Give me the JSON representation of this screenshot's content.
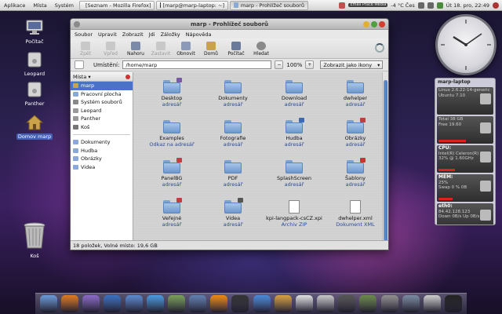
{
  "top_panel": {
    "menus": [
      "Aplikace",
      "Místa",
      "Systém"
    ],
    "tasks": [
      {
        "label": "[Seznam - Mozilla Firefox]",
        "active": false
      },
      {
        "label": "[marp@marp-laptop: ~]",
        "active": false
      },
      {
        "label": "marp - Prohlížeč souborů",
        "active": true
      }
    ],
    "email_badge": "Email Práce Média",
    "weather": "-4 °C Čes",
    "datetime": "Út 18. pro, 22:49"
  },
  "desktop": {
    "icons": [
      {
        "label": "Počítač",
        "selected": false
      },
      {
        "label": "Leopard",
        "selected": false
      },
      {
        "label": "Panther",
        "selected": false
      },
      {
        "label": "Domov marp",
        "selected": true
      },
      {
        "label": "Koš",
        "selected": false
      }
    ]
  },
  "window": {
    "title": "marp - Prohlížeč souborů",
    "menubar": [
      "Soubor",
      "Upravit",
      "Zobrazit",
      "Jdi",
      "Záložky",
      "Nápověda"
    ],
    "toolbar": [
      {
        "label": "Zpět",
        "icon": "back-arrow-icon",
        "enabled": false
      },
      {
        "label": "Vpřed",
        "icon": "forward-arrow-icon",
        "enabled": false
      },
      {
        "label": "Nahoru",
        "icon": "up-arrow-icon",
        "enabled": true
      },
      {
        "label": "Zastavit",
        "icon": "stop-icon",
        "enabled": false
      },
      {
        "label": "Obnovit",
        "icon": "refresh-icon",
        "enabled": true
      },
      {
        "label": "Domů",
        "icon": "home-icon",
        "enabled": true
      },
      {
        "label": "Počítač",
        "icon": "computer-icon",
        "enabled": true
      },
      {
        "label": "Hledat",
        "icon": "search-icon",
        "enabled": true
      }
    ],
    "location_label": "Umístění:",
    "location_value": "/home/marp",
    "zoom": "100%",
    "view_mode": "Zobrazit jako ikony",
    "sidebar": {
      "title": "Místa",
      "items": [
        {
          "label": "marp",
          "selected": true,
          "color": "#c9a24a"
        },
        {
          "label": "Pracovní plocha",
          "selected": false,
          "color": "#8aa8d8"
        },
        {
          "label": "Systém souborů",
          "selected": false,
          "color": "#888888"
        },
        {
          "label": "Leopard",
          "selected": false,
          "color": "#999999"
        },
        {
          "label": "Panther",
          "selected": false,
          "color": "#999999"
        },
        {
          "label": "Koš",
          "selected": false,
          "color": "#777777"
        }
      ],
      "bookmarks": [
        {
          "label": "Dokumenty",
          "color": "#8aa8d8"
        },
        {
          "label": "Hudba",
          "color": "#8aa8d8"
        },
        {
          "label": "Obrázky",
          "color": "#8aa8d8"
        },
        {
          "label": "Videa",
          "color": "#8aa8d8"
        }
      ]
    },
    "files": [
      {
        "name": "Desktop",
        "sub": "adresář",
        "type": "folder",
        "emblem": "#7a5aa8"
      },
      {
        "name": "Dokumenty",
        "sub": "adresář",
        "type": "folder",
        "emblem": ""
      },
      {
        "name": "Download",
        "sub": "adresář",
        "type": "folder",
        "emblem": ""
      },
      {
        "name": "dwhelper",
        "sub": "adresář",
        "type": "folder",
        "emblem": ""
      },
      {
        "name": "Examples",
        "sub": "Odkaz na adresář",
        "type": "folder",
        "emblem": ""
      },
      {
        "name": "Fotografie",
        "sub": "adresář",
        "type": "folder",
        "emblem": ""
      },
      {
        "name": "Hudba",
        "sub": "adresář",
        "type": "folder",
        "emblem": "#3a6ab8"
      },
      {
        "name": "Obrázky",
        "sub": "adresář",
        "type": "folder",
        "emblem": "#c04040"
      },
      {
        "name": "PanelBG",
        "sub": "adresář",
        "type": "folder",
        "emblem": "#c04040"
      },
      {
        "name": "PDF",
        "sub": "adresář",
        "type": "folder",
        "emblem": ""
      },
      {
        "name": "SplashScreen",
        "sub": "adresář",
        "type": "folder",
        "emblem": ""
      },
      {
        "name": "Šablony",
        "sub": "adresář",
        "type": "folder",
        "emblem": "#cc3333"
      },
      {
        "name": "Veřejné",
        "sub": "adresář",
        "type": "folder",
        "emblem": "#c04040"
      },
      {
        "name": "Videa",
        "sub": "adresář",
        "type": "folder",
        "emblem": "#555555"
      },
      {
        "name": "kpi-langpack-csCZ.xpi",
        "sub": "Archiv ZIP",
        "type": "doc",
        "emblem": ""
      },
      {
        "name": "dwhelper.xml",
        "sub": "Dokument XML",
        "type": "doc",
        "emblem": ""
      }
    ],
    "status": "18 položek, Volné místo: 19,6 GB"
  },
  "sysmon": {
    "title": "marp-laptop",
    "blocks": [
      {
        "title": "",
        "lines": [
          "Linux 2.6.22-14-generic",
          "Ubuntu 7.10"
        ],
        "bar": 0.0
      },
      {
        "title": "",
        "lines": [
          "Total 38 GB",
          "Free 19.60"
        ],
        "bar": 0.5
      },
      {
        "title": "CPU:",
        "lines": [
          "Intel(R) Celeron(R) M",
          "32% @ 1.60GHz"
        ],
        "bar": 0.3
      },
      {
        "title": "MEM:",
        "lines": [
          "25%",
          "Swap 0 % 0B"
        ],
        "bar": 0.25
      },
      {
        "title": "eth0:",
        "lines": [
          "84.42.128.123",
          "Down 0B/s Up 0B/s"
        ],
        "bar": 0.1
      },
      {
        "title": "ath0:",
        "lines": [
          "0.0.0.0",
          "Down 0B/s"
        ],
        "bar": 0.0
      }
    ]
  },
  "dock": {
    "icons": [
      {
        "name": "finder-icon",
        "color": "#6a9ad8"
      },
      {
        "name": "firefox-icon",
        "color": "#e07a20"
      },
      {
        "name": "pidgin-icon",
        "color": "#8a6ac8"
      },
      {
        "name": "thunderbird-icon",
        "color": "#3a70c0"
      },
      {
        "name": "network-icon",
        "color": "#5a8ad0"
      },
      {
        "name": "weather-icon",
        "color": "#4a9ae0"
      },
      {
        "name": "photos-icon",
        "color": "#7aa05a"
      },
      {
        "name": "preview-icon",
        "color": "#6080b0"
      },
      {
        "name": "vlc-icon",
        "color": "#f08a10"
      },
      {
        "name": "movie-icon",
        "color": "#333333"
      },
      {
        "name": "itunes-icon",
        "color": "#4a8ad8"
      },
      {
        "name": "cd-icon",
        "color": "#d8a040"
      },
      {
        "name": "chat-icon",
        "color": "#e0e0e0"
      },
      {
        "name": "trafficlight-icon",
        "color": "#c8c8c8"
      },
      {
        "name": "calculator-icon",
        "color": "#555555"
      },
      {
        "name": "books-icon",
        "color": "#6a8a4a"
      },
      {
        "name": "settings-icon",
        "color": "#909090"
      },
      {
        "name": "network-tool-icon",
        "color": "#7a8aa0"
      },
      {
        "name": "script-icon",
        "color": "#cccccc"
      },
      {
        "name": "terminal-icon",
        "color": "#222222"
      }
    ]
  }
}
